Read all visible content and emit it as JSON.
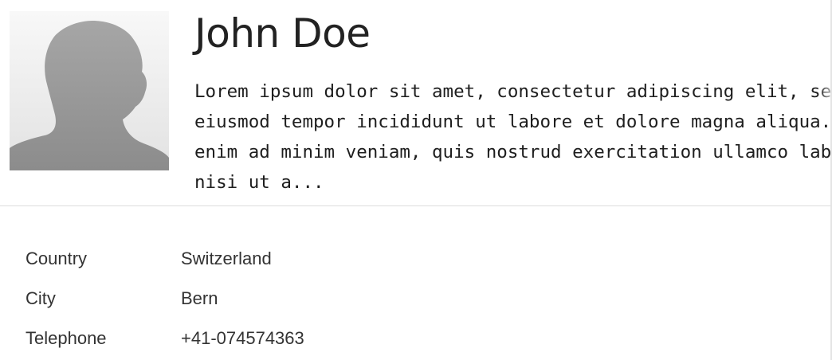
{
  "profile": {
    "name": "John Doe",
    "avatar_icon": "person-silhouette-icon",
    "bio_lines": [
      "Lorem ipsum dolor sit amet, consectetur adipiscing elit, sed do",
      "eiusmod tempor incididunt ut labore et dolore magna aliqua. Ut",
      "enim ad minim veniam, quis nostrud exercitation ullamco laboris",
      "nisi ut a..."
    ]
  },
  "details": {
    "rows": [
      {
        "label": "Country",
        "value": "Switzerland"
      },
      {
        "label": "City",
        "value": "Bern"
      },
      {
        "label": "Telephone",
        "value": "+41-074574363"
      }
    ]
  },
  "colors": {
    "avatar_silhouette": "#8f8f8f",
    "divider": "#dcdcdc"
  }
}
